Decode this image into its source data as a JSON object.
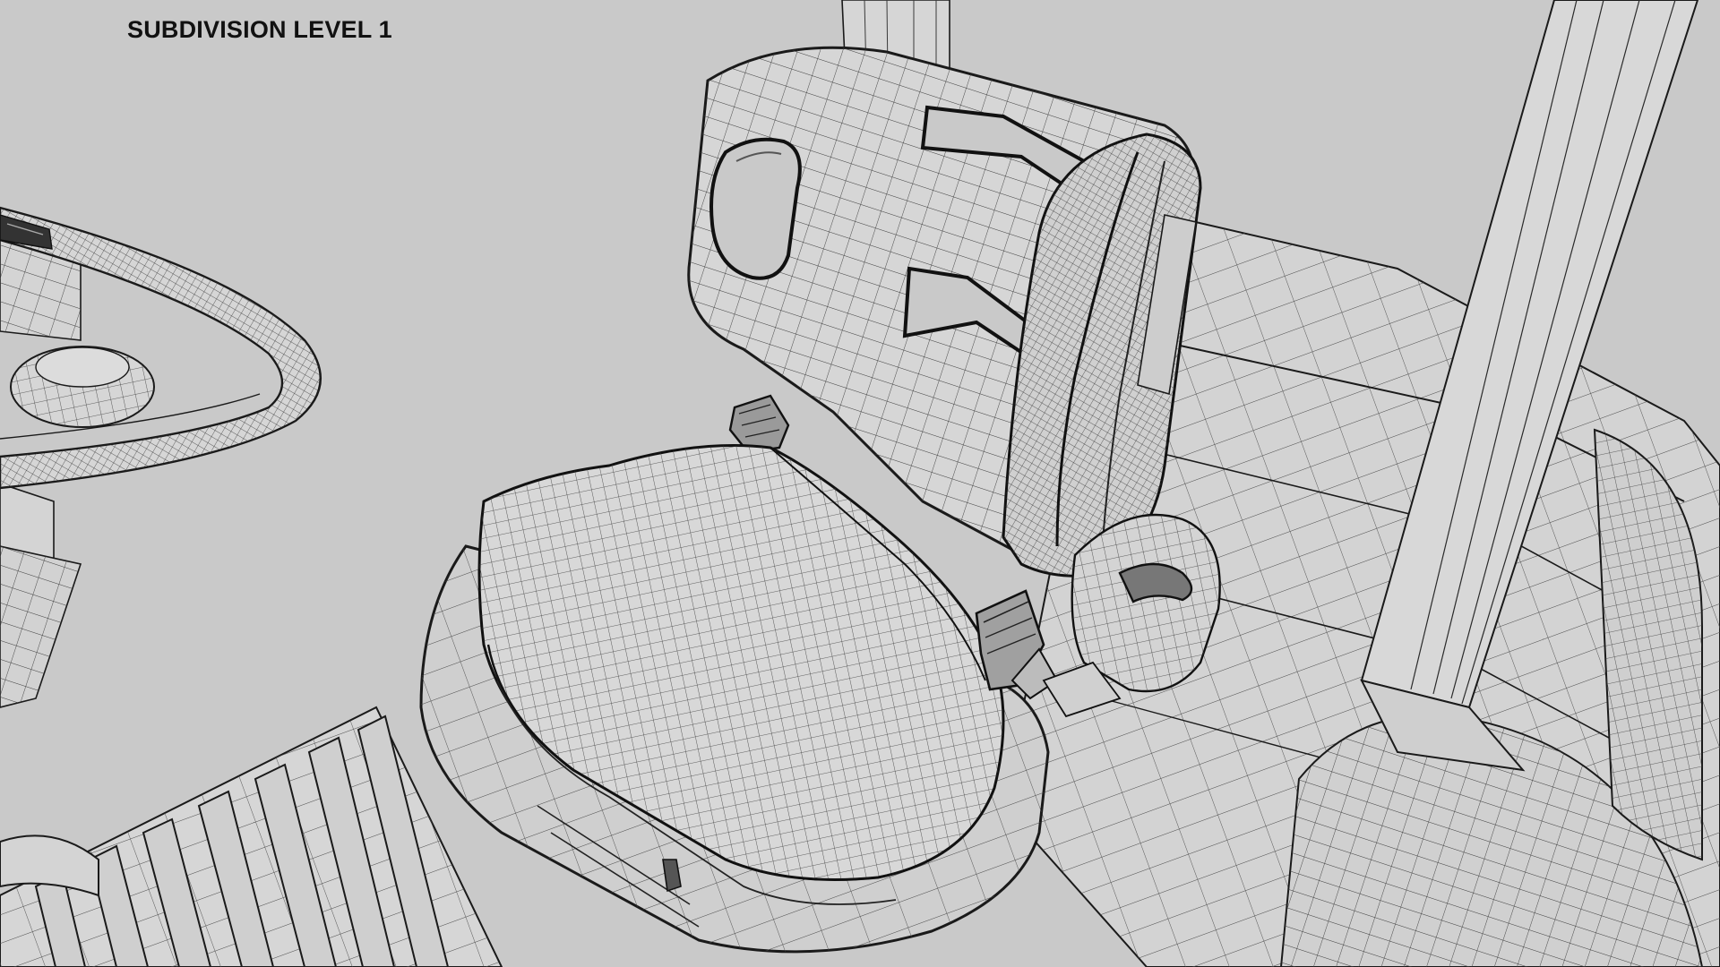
{
  "caption": {
    "text": "SUBDIVISION LEVEL 1"
  },
  "scene": {
    "render_mode": "wireframe",
    "subject": "forklift-operator-seat",
    "colors": {
      "background": "#c9c9c9",
      "surface": "#d2d2d2",
      "surface_light": "#dcdcdc",
      "wire": "#1a1a1a",
      "wire_light": "#5a5a5a",
      "dark": "#222222"
    }
  }
}
